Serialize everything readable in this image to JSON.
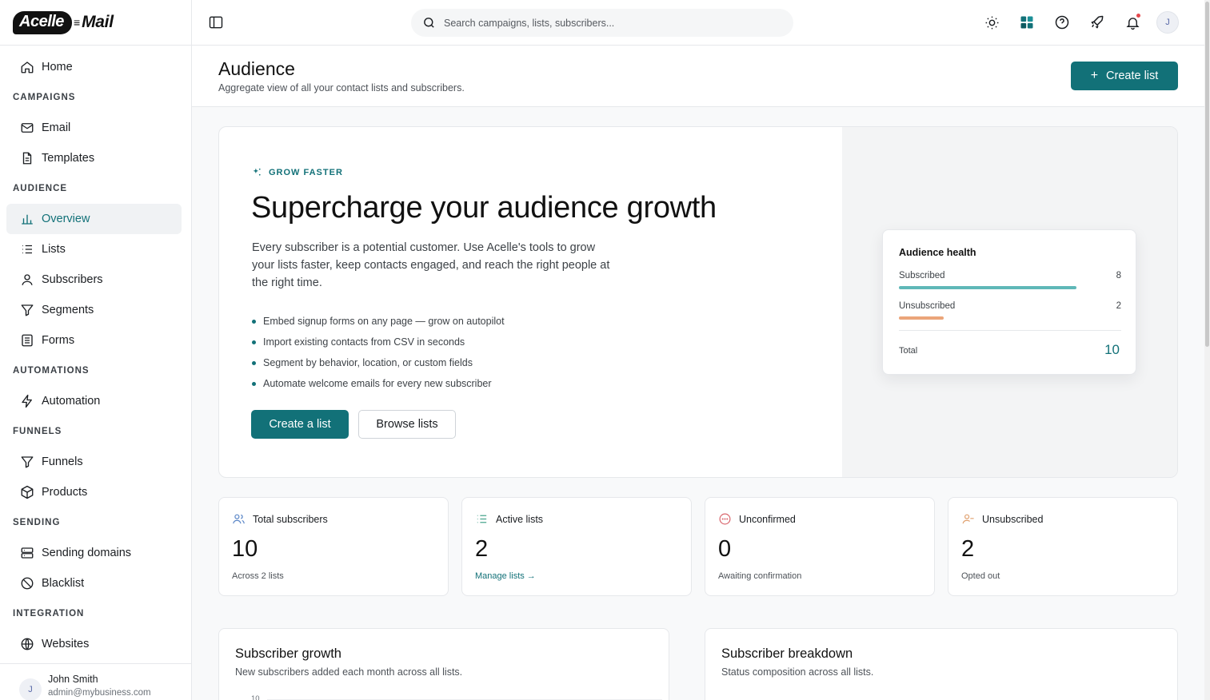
{
  "brand": {
    "logo_left": "Acelle",
    "logo_right": "Mail"
  },
  "search": {
    "placeholder": "Search campaigns, lists, subscribers..."
  },
  "sidebar": {
    "home": "Home",
    "sections": {
      "campaigns": "CAMPAIGNS",
      "audience": "AUDIENCE",
      "automations": "AUTOMATIONS",
      "funnels": "FUNNELS",
      "sending": "SENDING",
      "integration": "INTEGRATION"
    },
    "items": {
      "email": "Email",
      "templates": "Templates",
      "overview": "Overview",
      "lists": "Lists",
      "subscribers": "Subscribers",
      "segments": "Segments",
      "forms": "Forms",
      "automation": "Automation",
      "funnels": "Funnels",
      "products": "Products",
      "sending_domains": "Sending domains",
      "blacklist": "Blacklist",
      "websites": "Websites"
    },
    "user": {
      "initial": "J",
      "name": "John Smith",
      "email": "admin@mybusiness.com"
    }
  },
  "topbar": {
    "avatar_initial": "J"
  },
  "header": {
    "title": "Audience",
    "subtitle": "Aggregate view of all your contact lists and subscribers.",
    "create_button": "Create list"
  },
  "hero": {
    "eyebrow": "GROW FASTER",
    "title": "Supercharge your audience growth",
    "description": "Every subscriber is a potential customer. Use Acelle's tools to grow your lists faster, keep contacts engaged, and reach the right people at the right time.",
    "bullets": [
      "Embed signup forms on any page — grow on autopilot",
      "Import existing contacts from CSV in seconds",
      "Segment by behavior, location, or custom fields",
      "Automate welcome emails for every new subscriber"
    ],
    "primary_button": "Create a list",
    "secondary_button": "Browse lists"
  },
  "health": {
    "title": "Audience health",
    "subscribed_label": "Subscribed",
    "subscribed_value": "8",
    "unsubscribed_label": "Unsubscribed",
    "unsubscribed_value": "2",
    "total_label": "Total",
    "total_value": "10",
    "subscribed_fraction": 1.0,
    "unsubscribed_fraction": 0.25,
    "colors": {
      "subscribed": "#5fb8b8",
      "unsubscribed": "#eba57a"
    }
  },
  "stats": [
    {
      "label": "Total subscribers",
      "value": "10",
      "note": "Across 2 lists",
      "icon": "users-icon"
    },
    {
      "label": "Active lists",
      "value": "2",
      "note": "Manage lists →",
      "icon": "list-icon"
    },
    {
      "label": "Unconfirmed",
      "value": "0",
      "note": "Awaiting confirmation",
      "icon": "pending-icon"
    },
    {
      "label": "Unsubscribed",
      "value": "2",
      "note": "Opted out",
      "icon": "user-minus-icon"
    }
  ],
  "growth": {
    "title": "Subscriber growth",
    "subtitle": "New subscribers added each month across all lists.",
    "y_top_tick": "10"
  },
  "breakdown": {
    "title": "Subscriber breakdown",
    "subtitle": "Status composition across all lists."
  },
  "colors": {
    "accent": "#127178",
    "accent_light": "#5fb8b8",
    "warning": "#eba57a"
  }
}
